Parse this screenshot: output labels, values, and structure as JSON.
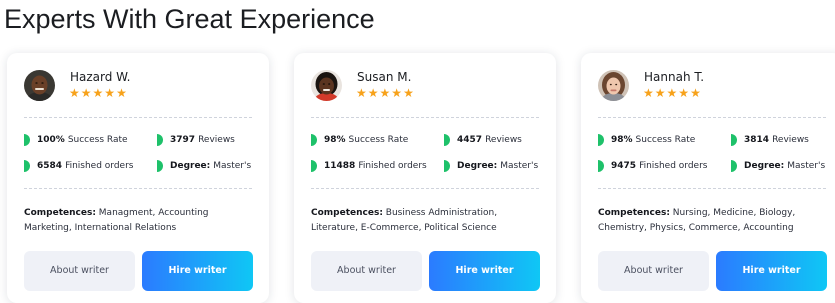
{
  "page": {
    "title": "Experts With Great Experience"
  },
  "colors": {
    "star": "#f7a21b",
    "stat_marker": "#1ec16a",
    "hire_gradient_start": "#2b7bff",
    "hire_gradient_end": "#0fc7f5",
    "about_bg": "#eff1f7"
  },
  "icons": {
    "rating": "star-icon",
    "stat": "half-pill-marker-icon"
  },
  "writers": [
    {
      "name": "Hazard W.",
      "rating": 5,
      "success_rate": "100%",
      "success_label": "Success Rate",
      "reviews": "3797",
      "reviews_label": "Reviews",
      "orders": "6584",
      "orders_label": "Finished orders",
      "degree_label": "Degree:",
      "degree": "Master's",
      "competences_label": "Competences:",
      "competences": "Managment, Accounting Marketing, International Relations",
      "about_label": "About writer",
      "hire_label": "Hire writer"
    },
    {
      "name": "Susan M.",
      "rating": 5,
      "success_rate": "98%",
      "success_label": "Success Rate",
      "reviews": "4457",
      "reviews_label": "Reviews",
      "orders": "11488",
      "orders_label": "Finished orders",
      "degree_label": "Degree:",
      "degree": "Master's",
      "competences_label": "Competences:",
      "competences": "Business Administration, Literature, E-Commerce, Political Science",
      "about_label": "About writer",
      "hire_label": "Hire writer"
    },
    {
      "name": "Hannah T.",
      "rating": 5,
      "success_rate": "98%",
      "success_label": "Success Rate",
      "reviews": "3814",
      "reviews_label": "Reviews",
      "orders": "9475",
      "orders_label": "Finished orders",
      "degree_label": "Degree:",
      "degree": "Master's",
      "competences_label": "Competences:",
      "competences": "Nursing, Medicine, Biology, Chemistry, Physics, Commerce, Accounting",
      "about_label": "About writer",
      "hire_label": "Hire writer"
    }
  ]
}
